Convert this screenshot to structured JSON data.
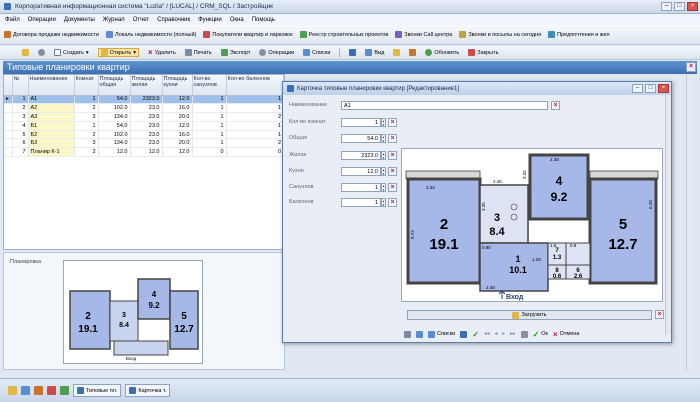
{
  "window": {
    "title": "Корпоративная информационная система \"Luzia\" / [LUCAL] / CRM_SQL / Застройщик"
  },
  "menu": [
    "Файл",
    "Операции",
    "Документы",
    "Журнал",
    "Отчет",
    "Справочник",
    "Функции",
    "Окна",
    "Помощь"
  ],
  "toolbar1": [
    {
      "label": "Договора продажи недвижимости",
      "icon": "contract-icon",
      "color": "#c8742c"
    },
    {
      "label": "Локаль недвижимости (полный)",
      "icon": "locale-icon",
      "color": "#5b8bd0"
    },
    {
      "label": "Покупатели квартир и парковок",
      "icon": "buyers-icon",
      "color": "#d04a4a"
    },
    {
      "label": "Реестр строительных проектов",
      "icon": "projects-icon",
      "color": "#4f9b4f"
    },
    {
      "label": "Звонки Call центра",
      "icon": "phone-icon",
      "color": "#7a5fc0"
    },
    {
      "label": "Звонки и посылы на сегодня",
      "icon": "calls-today-icon",
      "color": "#c0a43c"
    },
    {
      "label": "Предпочтения и жел",
      "icon": "preferences-icon",
      "color": "#3c8fb0"
    }
  ],
  "toolbar2": {
    "create": "Создать",
    "open": "Открыть",
    "delete": "Удалить",
    "print": "Печать",
    "export": "Экспорт",
    "operations": "Операции",
    "lists": "Списки",
    "view": "Вид",
    "refresh": "Обновить",
    "close": "Закрыть"
  },
  "page": {
    "title": "Типовые планировки квартир"
  },
  "grid": {
    "columns": [
      "№",
      "Наименование",
      "Комнат",
      "Площадь общая",
      "Площадь жилая",
      "Площадь кухни",
      "Кол-во санузлов",
      "Кол-во балконов"
    ],
    "rows": [
      [
        "1",
        "А1",
        "1",
        "54.0",
        "2323.0",
        "12.0",
        "1",
        "1"
      ],
      [
        "2",
        "А2",
        "2",
        "102.0",
        "23.0",
        "16.0",
        "1",
        "1"
      ],
      [
        "3",
        "А3",
        "3",
        "134.0",
        "23.0",
        "20.0",
        "1",
        "2"
      ],
      [
        "4",
        "Б1",
        "1",
        "54.0",
        "23.0",
        "12.0",
        "1",
        "1"
      ],
      [
        "5",
        "Б2",
        "2",
        "102.0",
        "23.0",
        "16.0",
        "1",
        "1"
      ],
      [
        "6",
        "Б3",
        "3",
        "134.0",
        "23.0",
        "20.0",
        "1",
        "2"
      ],
      [
        "7",
        "Планир К-1",
        "2",
        "12.0",
        "12.0",
        "12.0",
        "0",
        "0"
      ]
    ],
    "selected_row": 0
  },
  "lower": {
    "label": "Планировка"
  },
  "thumb": {
    "rooms": [
      {
        "num": "2",
        "area": "19.1"
      },
      {
        "num": "3",
        "area": "8.4"
      },
      {
        "num": "4",
        "area": "9.2"
      },
      {
        "num": "5",
        "area": "12.7"
      }
    ],
    "entrance": "Вход"
  },
  "dialog": {
    "title": "Карточка типовые планировки квартир [Редактирование1]",
    "fields": {
      "name_label": "Наименование",
      "name_value": "А1",
      "rooms_label": "Кол-во комнат",
      "rooms_value": "1",
      "total_label": "Общая",
      "total_value": "54.0",
      "living_label": "Жилая",
      "living_value": "2323.0",
      "kitchen_label": "Кухня",
      "kitchen_value": "12.0",
      "bath_label": "Санузлов",
      "bath_value": "1",
      "balcony_label": "Балконов",
      "balcony_value": "1"
    },
    "upload": "Загрузить",
    "footer": {
      "lists": "Списки",
      "ok": "Ок",
      "cancel": "Отмена"
    }
  },
  "plan": {
    "rooms": [
      {
        "num": "2",
        "area": "19.1"
      },
      {
        "num": "3",
        "area": "8.4"
      },
      {
        "num": "4",
        "area": "9.2"
      },
      {
        "num": "5",
        "area": "12.7"
      },
      {
        "num": "1",
        "area": "10.1"
      },
      {
        "num": "8",
        "area": "0.6"
      },
      {
        "num": "6",
        "area": "2.6"
      },
      {
        "num": "7",
        "area": "1.3"
      }
    ],
    "dims": {
      "d1": "3.34",
      "d2": "2.46",
      "d3": "3.32",
      "d4": "2.38",
      "d5": "5.73",
      "d6": "3.35",
      "d7": "6.10",
      "d8": "0.90",
      "d9": "1.28",
      "d10": "2.48",
      "d11": "1.5",
      "d12": "0.9"
    },
    "entrance": "Вход"
  },
  "taskbar": {
    "tab1": "Типовые пл.",
    "tab2": "Карточка т."
  },
  "colors": {
    "room_fill": "#a6b8e8",
    "wall": "#444444",
    "title_blue": "#3b6fb0",
    "close_red": "#d9534f"
  }
}
